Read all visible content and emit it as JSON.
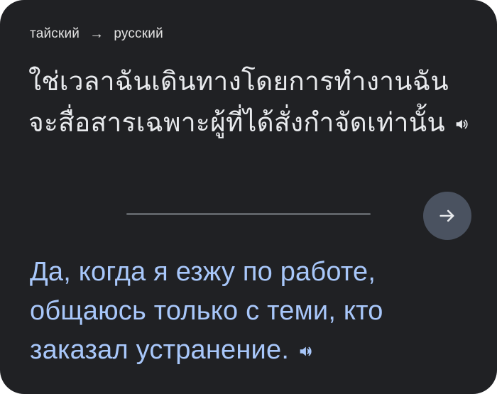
{
  "languages": {
    "source": "тайский",
    "target": "русский"
  },
  "source_text": "ใช่เวลาฉันเดินทางโดยการทำงานฉันจะสื่อสารเฉพาะผู้ที่ได้สั่งกำจัดเท่านั้น",
  "translation_text": "Да, когда я езжу по работе, общаюсь только с теми, кто заказал устранение.",
  "icons": {
    "language_arrow": "arrow-right-icon",
    "speaker": "speaker-icon",
    "go": "arrow-right-icon"
  },
  "colors": {
    "background": "#202124",
    "source_text": "#e8eaed",
    "translation_text": "#a8c7fa",
    "button": "#4a5260",
    "divider": "#5f6368"
  }
}
